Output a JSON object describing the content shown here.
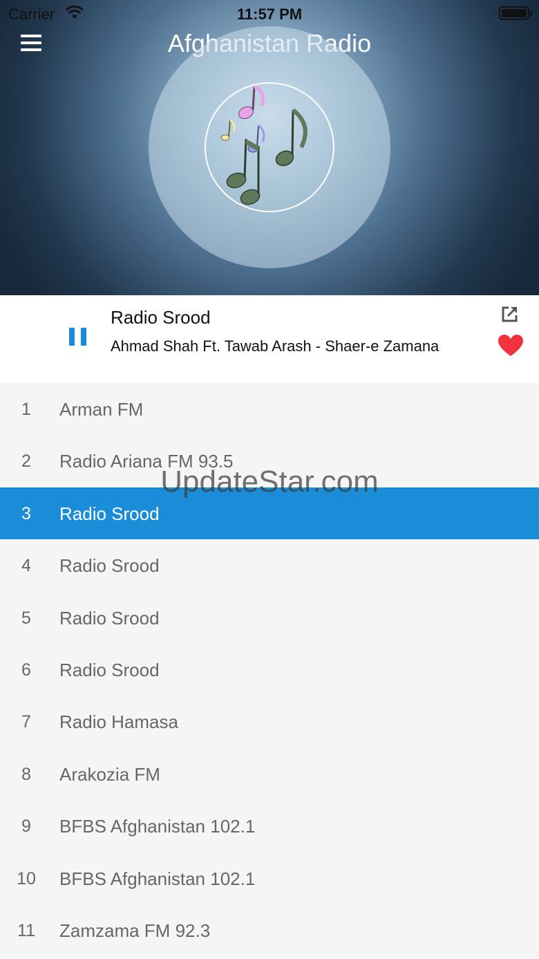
{
  "status_bar": {
    "carrier": "Carrier",
    "time": "11:57 PM"
  },
  "header": {
    "title": "Afghanistan Radio"
  },
  "now_playing": {
    "station": "Radio Srood",
    "track": "Ahmad Shah Ft. Tawab Arash - Shaer-e Zamana",
    "state": "playing",
    "favorite_color": "#f2333f"
  },
  "stations": [
    {
      "num": "1",
      "name": "Arman FM"
    },
    {
      "num": "2",
      "name": "Radio Ariana FM 93.5"
    },
    {
      "num": "3",
      "name": "Radio Srood"
    },
    {
      "num": "4",
      "name": "Radio Srood"
    },
    {
      "num": "5",
      "name": "Radio Srood"
    },
    {
      "num": "6",
      "name": "Radio Srood"
    },
    {
      "num": "7",
      "name": "Radio Hamasa"
    },
    {
      "num": "8",
      "name": "Arakozia FM"
    },
    {
      "num": "9",
      "name": "BFBS Afghanistan 102.1"
    },
    {
      "num": "10",
      "name": "BFBS Afghanistan 102.1"
    },
    {
      "num": "11",
      "name": "Zamzama FM 92.3"
    }
  ],
  "selected_station": "3",
  "accent_color": "#1a8cd8",
  "watermark": "UpdateStar.com"
}
